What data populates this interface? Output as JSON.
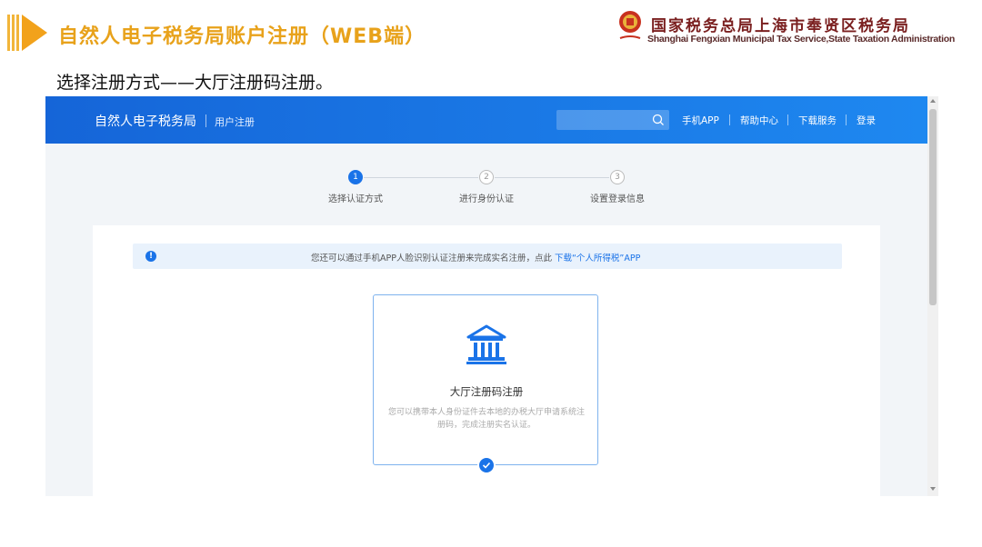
{
  "slide": {
    "title": "自然人电子税务局账户注册（WEB端）",
    "org_cn": "国家税务总局上海市奉贤区税务局",
    "org_en": "Shanghai Fengxian Municipal Tax Service,State Taxation Administration",
    "subtitle": "选择注册方式——大厅注册码注册。"
  },
  "header": {
    "brand": "自然人电子税务局",
    "sub": "用户注册",
    "search_placeholder": "",
    "nav": [
      "手机APP",
      "帮助中心",
      "下载服务",
      "登录"
    ]
  },
  "steps": [
    {
      "num": "1",
      "label": "选择认证方式",
      "active": true
    },
    {
      "num": "2",
      "label": "进行身份认证",
      "active": false
    },
    {
      "num": "3",
      "label": "设置登录信息",
      "active": false
    }
  ],
  "notice": {
    "text": "您还可以通过手机APP人脸识别认证注册来完成实名注册，点此",
    "link": "下载“个人所得税”APP"
  },
  "card": {
    "title": "大厅注册码注册",
    "desc": "您可以携带本人身份证件去本地的办税大厅申请系统注册码，完成注册实名认证。"
  },
  "colors": {
    "accent": "#1a73e8",
    "title_orange": "#e8a21b",
    "org_red": "#7a1f1f"
  },
  "icons": {
    "search": "search-icon",
    "building": "building-icon",
    "check": "check-icon",
    "info": "info-icon"
  }
}
